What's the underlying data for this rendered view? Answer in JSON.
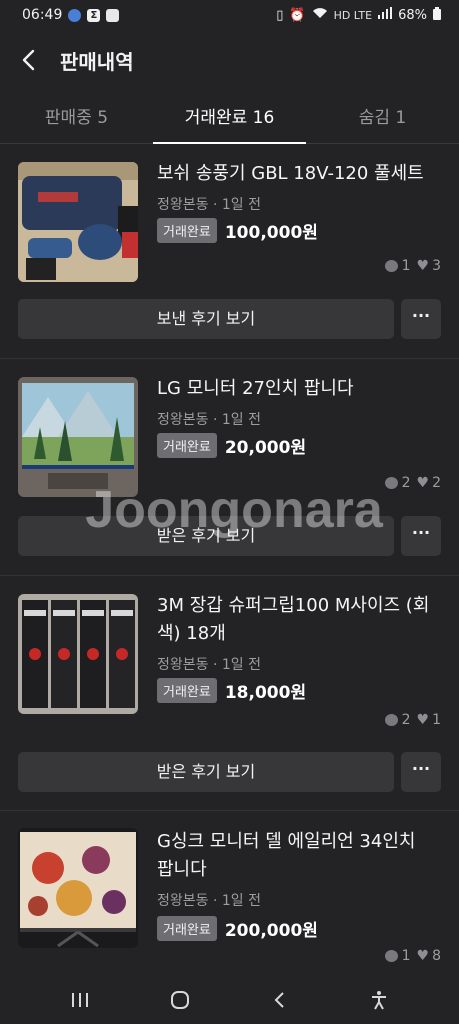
{
  "status_bar": {
    "time": "06:49",
    "network": "HD LTE",
    "battery": "68%"
  },
  "header": {
    "title": "판매내역"
  },
  "tabs": [
    {
      "label": "판매중 5",
      "active": false
    },
    {
      "label": "거래완료 16",
      "active": true
    },
    {
      "label": "숨김 1",
      "active": false
    }
  ],
  "items": [
    {
      "title": "보쉬 송풍기 GBL 18V-120 풀세트",
      "meta": "정왕본동 · 1일 전",
      "status": "거래완료",
      "price": "100,000원",
      "chats": "1",
      "likes": "3",
      "review_button": "보낸 후기 보기"
    },
    {
      "title": "LG 모니터 27인치 팝니다",
      "meta": "정왕본동 · 1일 전",
      "status": "거래완료",
      "price": "20,000원",
      "chats": "2",
      "likes": "2",
      "review_button": "받은 후기 보기"
    },
    {
      "title": "3M 장갑 슈퍼그립100 M사이즈 (회색) 18개",
      "meta": "정왕본동 · 1일 전",
      "status": "거래완료",
      "price": "18,000원",
      "chats": "2",
      "likes": "1",
      "review_button": "받은 후기 보기"
    },
    {
      "title": "G싱크 모니터 델 에일리언 34인치 팝니다",
      "meta": "정왕본동 · 1일 전",
      "status": "거래완료",
      "price": "200,000원",
      "chats": "1",
      "likes": "8"
    }
  ],
  "more_label": "···",
  "watermark": "Joongonara",
  "colors": {
    "background": "#232325",
    "button": "#37373a",
    "badge": "#6e6e72"
  }
}
